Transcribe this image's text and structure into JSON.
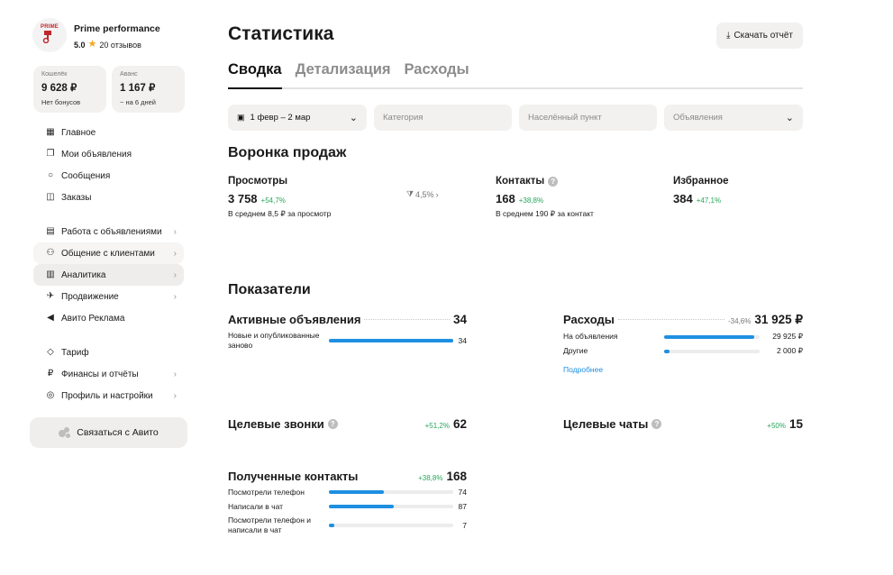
{
  "profile": {
    "name": "Prime performance",
    "rating": "5.0",
    "reviews": "20 отзывов",
    "logo_text": "PRIME"
  },
  "wallets": [
    {
      "label": "Кошелёк",
      "value": "9 628 ₽",
      "sub": "Нет бонусов"
    },
    {
      "label": "Аванс",
      "value": "1 167 ₽",
      "sub": "~ на 6 дней"
    }
  ],
  "nav": {
    "group1": [
      {
        "label": "Главное",
        "icon": "grid-icon"
      },
      {
        "label": "Мои объявления",
        "icon": "copy-icon"
      },
      {
        "label": "Сообщения",
        "icon": "chat-icon"
      },
      {
        "label": "Заказы",
        "icon": "box-icon"
      }
    ],
    "group2": [
      {
        "label": "Работа с объявлениями",
        "icon": "ad-icon",
        "chevron": true
      },
      {
        "label": "Общение с клиентами",
        "icon": "people-icon",
        "chevron": true
      },
      {
        "label": "Аналитика",
        "icon": "chart-icon",
        "chevron": true
      },
      {
        "label": "Продвижение",
        "icon": "rocket-icon",
        "chevron": true
      },
      {
        "label": "Авито Реклама",
        "icon": "megaphone-icon"
      }
    ],
    "group3": [
      {
        "label": "Тариф",
        "icon": "diamond-icon"
      },
      {
        "label": "Финансы и отчёты",
        "icon": "ruble-icon",
        "chevron": true
      },
      {
        "label": "Профиль и настройки",
        "icon": "settings-icon",
        "chevron": true
      }
    ]
  },
  "contact_button": "Связаться с Авито",
  "page": {
    "title": "Статистика",
    "download": "Скачать отчёт"
  },
  "tabs": [
    "Сводка",
    "Детализация",
    "Расходы"
  ],
  "filters": {
    "date": "1 февр – 2 мар",
    "category": "Категория",
    "city": "Населённый пункт",
    "ads": "Объявления"
  },
  "funnel": {
    "title": "Воронка продаж",
    "views": {
      "label": "Просмотры",
      "value": "3 758",
      "delta": "+54,7%",
      "sub": "В среднем 8,5 ₽ за просмотр"
    },
    "conversion": "4,5%",
    "contacts": {
      "label": "Контакты",
      "value": "168",
      "delta": "+38,8%",
      "sub": "В среднем 190 ₽ за контакт"
    },
    "favorites": {
      "label": "Избранное",
      "value": "384",
      "delta": "+47,1%"
    }
  },
  "metrics": {
    "title": "Показатели",
    "active_ads": {
      "label": "Активные объявления",
      "value": "34",
      "rows": [
        {
          "label": "Новые и опубликованные заново",
          "value": "34",
          "fraction": 1.0
        }
      ]
    },
    "expenses": {
      "label": "Расходы",
      "delta": "-34,6%",
      "value": "31 925 ₽",
      "rows": [
        {
          "label": "На объявления",
          "value": "29 925 ₽",
          "fraction": 0.94
        },
        {
          "label": "Другие",
          "value": "2 000 ₽",
          "fraction": 0.06
        }
      ],
      "more": "Подробнее"
    },
    "calls": {
      "label": "Целевые звонки",
      "delta": "+51,2%",
      "value": "62"
    },
    "chats": {
      "label": "Целевые чаты",
      "delta": "+50%",
      "value": "15"
    },
    "contacts": {
      "label": "Полученные контакты",
      "delta": "+38,8%",
      "value": "168",
      "rows": [
        {
          "label": "Посмотрели телефон",
          "value": "74",
          "fraction": 0.44
        },
        {
          "label": "Написали в чат",
          "value": "87",
          "fraction": 0.52
        },
        {
          "label": "Посмотрели телефон и написали в чат",
          "value": "7",
          "fraction": 0.04
        }
      ]
    }
  },
  "colors": {
    "accent": "#1e8fe1",
    "positive": "#26a65b",
    "bg_soft": "#f2f1f0"
  }
}
